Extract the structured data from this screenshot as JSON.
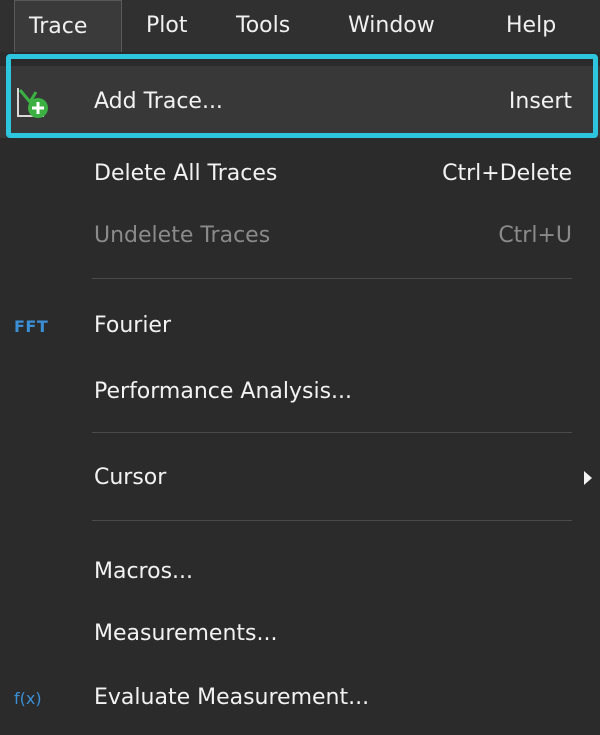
{
  "menubar": {
    "items": [
      {
        "label": "Trace"
      },
      {
        "label": "Plot"
      },
      {
        "label": "Tools"
      },
      {
        "label": "Window"
      },
      {
        "label": "Help"
      }
    ]
  },
  "menu": {
    "add_trace": {
      "label": "Add Trace...",
      "shortcut": "Insert",
      "icon": "add-trace-icon"
    },
    "delete_all": {
      "label": "Delete All Traces",
      "shortcut": "Ctrl+Delete"
    },
    "undelete": {
      "label": "Undelete Traces",
      "shortcut": "Ctrl+U",
      "enabled": false
    },
    "fourier": {
      "label": "Fourier",
      "icon_text": "FFT"
    },
    "performance": {
      "label": "Performance Analysis..."
    },
    "cursor": {
      "label": "Cursor",
      "has_submenu": true
    },
    "macros": {
      "label": "Macros..."
    },
    "measurements": {
      "label": "Measurements..."
    },
    "evaluate": {
      "label": "Evaluate Measurement...",
      "icon_text": "f(x)"
    }
  },
  "colors": {
    "highlight": "#2ec5de",
    "icon_blue": "#3b8fd6",
    "icon_green": "#3cb043",
    "background": "#2b2b2b",
    "disabled_text": "#8a8a8a"
  }
}
